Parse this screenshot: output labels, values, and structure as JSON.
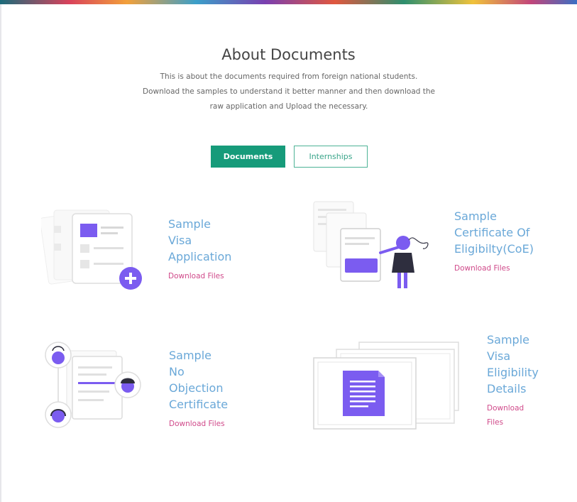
{
  "section": {
    "title": "About Documents",
    "description_lines": [
      "This is about the documents required from foreign national students.",
      "Download the samples to understand it better manner and then download the",
      "raw application and Upload the necessary."
    ]
  },
  "tabs": [
    {
      "label": "Documents",
      "active": true
    },
    {
      "label": "Internships",
      "active": false
    }
  ],
  "documents": [
    {
      "title_lines": [
        "Sample Visa",
        "Application"
      ],
      "download_label": "Download Files"
    },
    {
      "title_lines": [
        "Sample",
        "Certificate Of",
        "Eligibilty(CoE)"
      ],
      "download_label": "Download Files"
    },
    {
      "title_lines": [
        "Sample No",
        "Objection",
        "Certificate"
      ],
      "download_label": "Download Files"
    },
    {
      "title_lines": [
        "Sample",
        "Visa",
        "Eligibility",
        "Details"
      ],
      "download_label": "Download Files"
    }
  ],
  "colors": {
    "accent_green": "#169b7a",
    "illustration_purple": "#7b5cf0",
    "title_blue": "#6aa8d8",
    "link_pink": "#d04a8a"
  }
}
